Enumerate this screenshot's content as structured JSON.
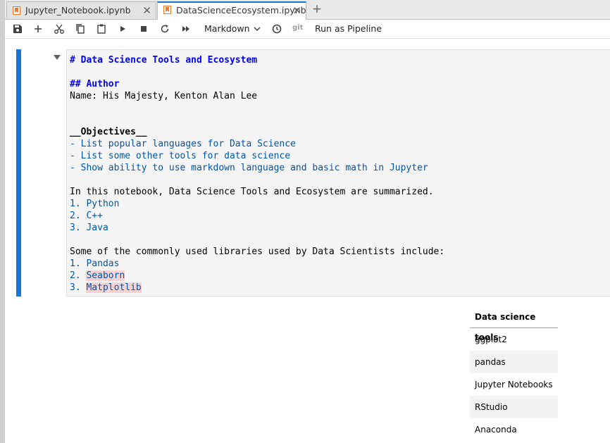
{
  "tabs": [
    {
      "label": "Jupyter_Notebook.ipynb",
      "active": false
    },
    {
      "label": "DataScienceEcosystem.ipynb",
      "active": true
    }
  ],
  "toolbar": {
    "cell_type": "Markdown",
    "git_label": "git",
    "pipeline_label": "Run as Pipeline",
    "icons": [
      "save-icon",
      "add-cell-icon",
      "cut-icon",
      "copy-icon",
      "paste-icon",
      "run-icon",
      "stop-icon",
      "restart-icon",
      "fast-forward-icon",
      "clock-icon"
    ]
  },
  "cell": {
    "lines": [
      {
        "text": "# Data Science Tools and Ecosystem",
        "style": "h"
      },
      {
        "text": "",
        "style": "blk"
      },
      {
        "text": "## Author",
        "style": "h"
      },
      {
        "text": "Name: His Majesty, Kenton Alan Lee",
        "style": "blk"
      },
      {
        "text": "",
        "style": "blk"
      },
      {
        "text": "",
        "style": "blk"
      },
      {
        "text": "__Objectives__",
        "style": "b"
      },
      {
        "text": "- List popular languages for Data Science",
        "style": "li"
      },
      {
        "text": "- List some other tools for data science",
        "style": "li"
      },
      {
        "text": "- Show ability to use markdown language and basic math in Jupyter",
        "style": "li"
      },
      {
        "text": "",
        "style": "blk"
      },
      {
        "text": "In this notebook, Data Science Tools and Ecosystem are summarized.",
        "style": "blk"
      },
      {
        "text": "1. Python",
        "style": "li"
      },
      {
        "text": "2. C++",
        "style": "li"
      },
      {
        "text": "3. Java",
        "style": "li"
      },
      {
        "text": "",
        "style": "blk"
      },
      {
        "text": "Some of the commonly used libraries used by Data Scientists include:",
        "style": "blk"
      },
      {
        "text": "1. Pandas",
        "style": "li"
      },
      {
        "prefix": "2. ",
        "word": "Seaborn",
        "style": "li-err"
      },
      {
        "prefix": "3. ",
        "word": "Matplotlib",
        "style": "li-err"
      }
    ]
  },
  "table": {
    "header": "Data science tools",
    "rows": [
      "ggplot2",
      "pandas",
      "Jupyter Notebooks",
      "RStudio",
      "Anaconda"
    ]
  },
  "colors": {
    "accent": "#1976d2",
    "heading": "#0000ff",
    "list": "#0055aa",
    "spellcheck": "#f6d3d3"
  }
}
